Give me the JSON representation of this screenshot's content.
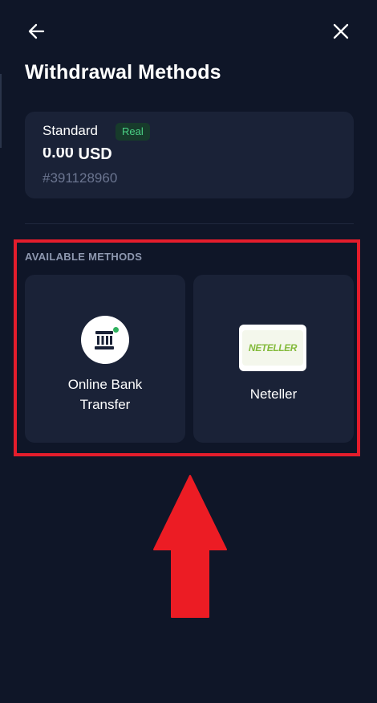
{
  "page": {
    "title": "Withdrawal Methods"
  },
  "account": {
    "type": "Standard",
    "badge": "Real",
    "balance_masked": "0.00",
    "currency": "USD",
    "id": "#391128960"
  },
  "methods": {
    "section_label": "AVAILABLE METHODS",
    "items": [
      {
        "label": "Online Bank Transfer",
        "line1": "Online Bank",
        "line2": "Transfer",
        "icon": "bank-icon"
      },
      {
        "label": "Neteller",
        "logo_text": "NETELLER",
        "icon": "neteller-logo"
      }
    ]
  },
  "icons": {
    "back": "arrow-left-icon",
    "close": "close-icon"
  },
  "colors": {
    "background": "#0f1628",
    "card": "#1a2237",
    "badge_text": "#4bd186",
    "badge_bg": "#173b2b",
    "highlight": "#e41d2c",
    "neteller_green": "#83ba3b"
  }
}
